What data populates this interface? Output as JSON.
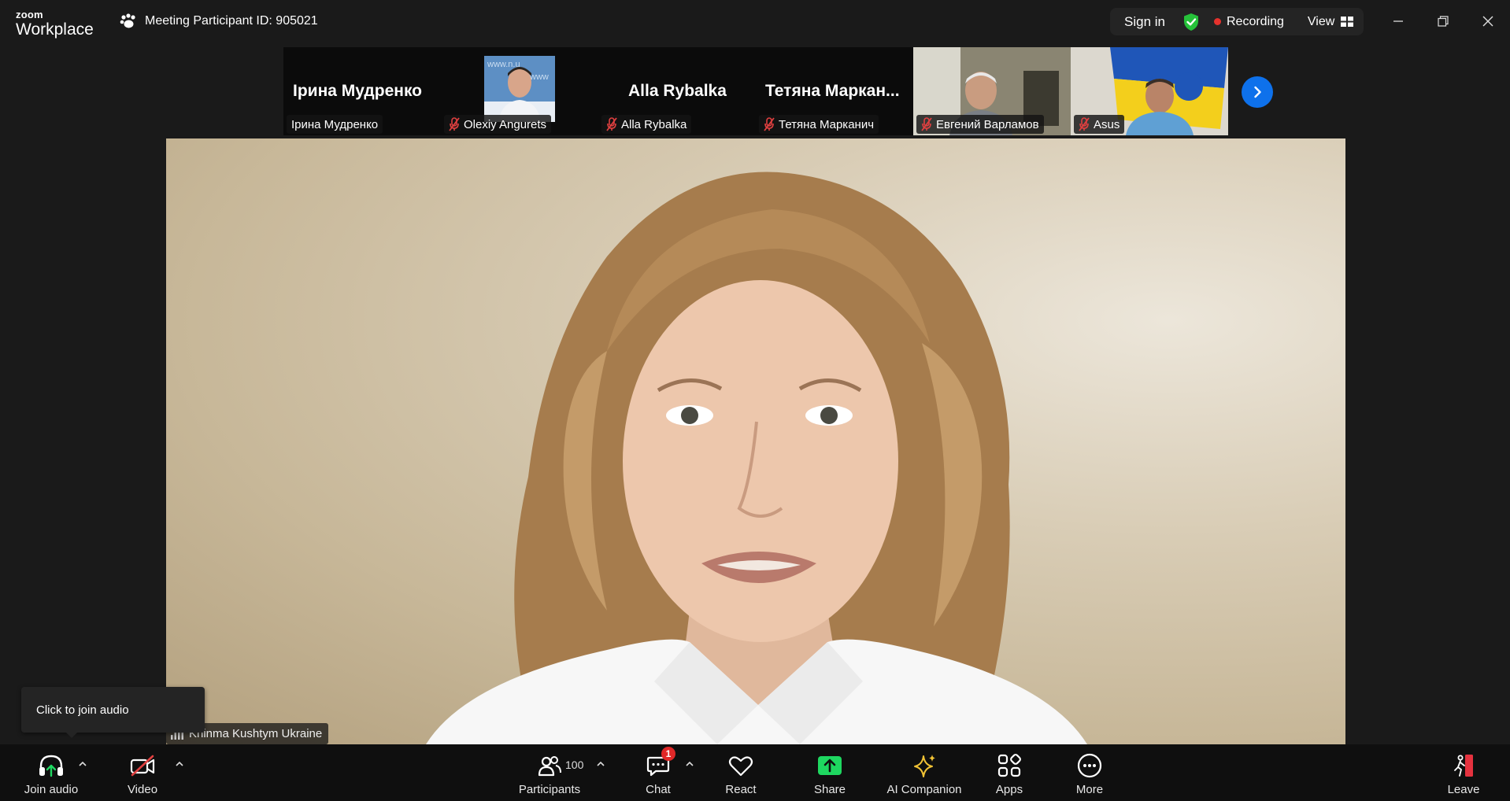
{
  "app": {
    "brand_top": "zoom",
    "brand_bottom": "Workplace",
    "meeting_id": "Meeting Participant ID: 905021"
  },
  "header": {
    "sign_in": "Sign in",
    "recording": "Recording",
    "view": "View"
  },
  "filmstrip": {
    "tiles": [
      {
        "big_name": "Ірина Мудренко",
        "label": "Ірина Мудренко",
        "muted": false
      },
      {
        "big_name": "",
        "label": "Olexiy Angurets",
        "muted": true
      },
      {
        "big_name": "Alla Rybalka",
        "label": "Alla Rybalka",
        "muted": true
      },
      {
        "big_name": "Тетяна  Маркан...",
        "label": "Тетяна Марканич",
        "muted": true
      },
      {
        "big_name": "",
        "label": "Евгений Варламов",
        "muted": true
      },
      {
        "big_name": "",
        "label": "Asus",
        "muted": true
      }
    ]
  },
  "main_video": {
    "speaker": "Kninma Kushtym Ukraine"
  },
  "tooltip": {
    "text": "Click to join audio"
  },
  "toolbar": {
    "join_audio": "Join audio",
    "video": "Video",
    "participants": "Participants",
    "participant_count": "100",
    "chat": "Chat",
    "chat_badge": "1",
    "react": "React",
    "share": "Share",
    "ai_companion": "AI Companion",
    "apps": "Apps",
    "more": "More",
    "leave": "Leave"
  },
  "colors": {
    "accent_blue": "#0e71eb",
    "share_green": "#1ed760",
    "shield_green": "#26c23a",
    "recording_red": "#e5322d",
    "mute_red": "#e04040",
    "ai_gold": "#f2c335"
  }
}
